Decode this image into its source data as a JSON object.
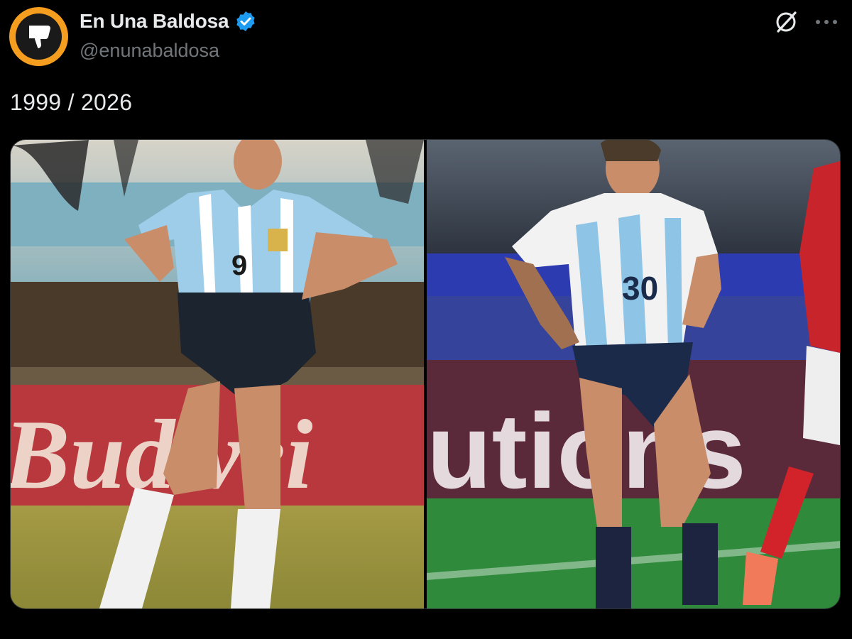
{
  "author": {
    "display_name": "En Una Baldosa",
    "handle": "@enunabaldosa",
    "verified": true,
    "avatar_icon": "thumbs-down-icon"
  },
  "header_actions": {
    "grok_icon": "grok-icon",
    "more_icon": "more-options-icon"
  },
  "post": {
    "text": "1999 / 2026"
  },
  "media": {
    "count": 2
  },
  "colors": {
    "background": "#000000",
    "text_primary": "#e7e9ea",
    "text_secondary": "#71767b",
    "verified_blue": "#1d9bf0",
    "avatar_ring": "#f59d1e"
  }
}
